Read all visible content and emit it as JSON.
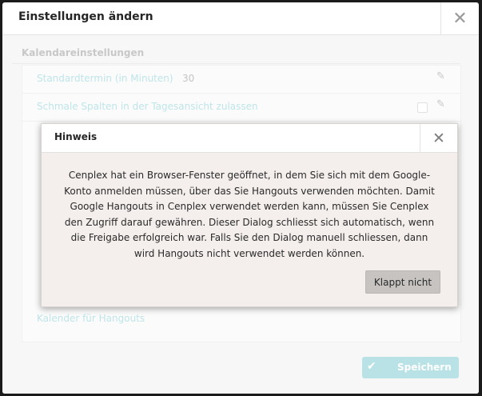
{
  "outer_dialog": {
    "title": "Einstellungen ändern",
    "close_glyph": "✕",
    "section_title": "Kalendareinstellungen",
    "rows": [
      {
        "label": "Standardtermin (in Minuten)",
        "value": "30",
        "edit_glyph": "✎"
      },
      {
        "label": "Schmale Spalten in der Tagesansicht zulassen",
        "edit_glyph": "✎"
      },
      {
        "label": "Kalender für Hangouts"
      }
    ],
    "save_check_glyph": "✔",
    "save_label": "Speichern"
  },
  "hint_dialog": {
    "title": "Hinweis",
    "close_glyph": "✕",
    "message": "Cenplex hat ein Browser-Fenster geöffnet, in dem Sie sich mit dem Google-Konto anmelden müssen, über das Sie Hangouts verwenden möchten. Damit Google Hangouts in Cenplex verwendet werden kann, müssen Sie Cenplex den Zugriff darauf gewähren. Dieser Dialog schliesst sich automatisch, wenn die Freigabe erfolgreich war. Falls Sie den Dialog manuell schliessen, dann wird Hangouts nicht verwendet werden können.",
    "button_label": "Klappt nicht"
  },
  "colors": {
    "accent_teal": "#b9e2e6",
    "dialog_bg": "#f4efec",
    "button_gray": "#c6c3c1"
  },
  "icons": [
    "close-icon",
    "edit-icon",
    "checkbox",
    "check-icon"
  ]
}
